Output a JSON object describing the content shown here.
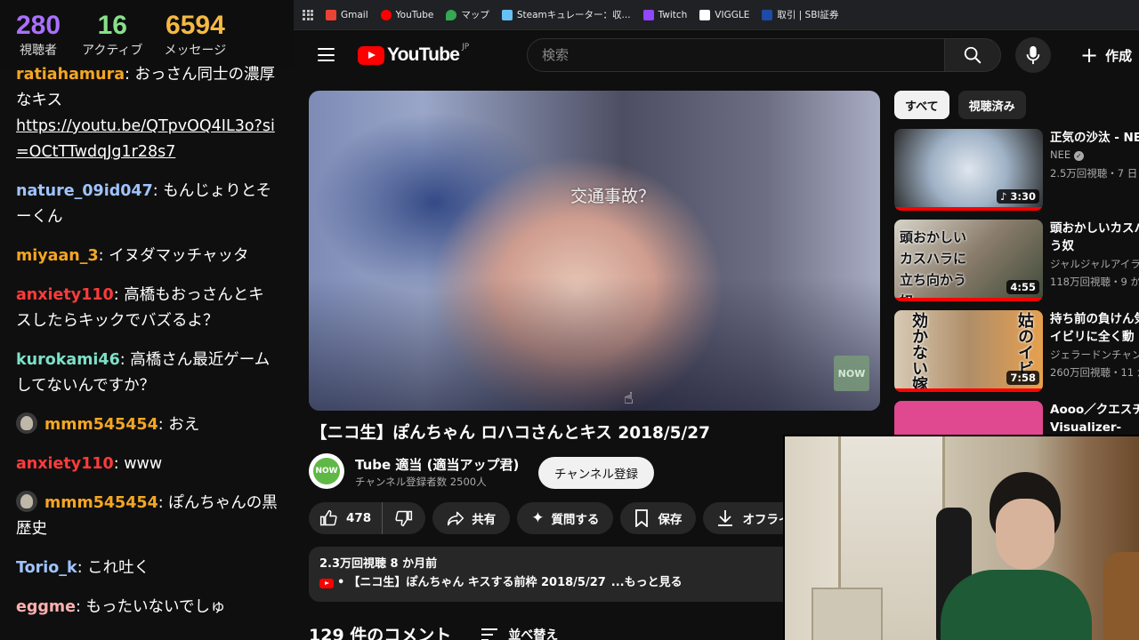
{
  "stream_stats": [
    {
      "value": "280",
      "label": "視聴者",
      "color": "#a970ff"
    },
    {
      "value": "16",
      "label": "アクティブ",
      "color": "#87e08a"
    },
    {
      "value": "6594",
      "label": "メッセージ",
      "color": "#f5b942"
    }
  ],
  "chat": [
    {
      "user": "ratiahamura",
      "color": "#f5a623",
      "text": ": おっさん同士の濃厚なキス",
      "link": "https://youtu.be/QTpvOQ4IL3o?si=OCtTTwdqJg1r28s7",
      "avatar": false
    },
    {
      "user": "nature_09id047",
      "color": "#9fc3ff",
      "text": ": もんじょりとそーくん",
      "avatar": false
    },
    {
      "user": "miyaan_3",
      "color": "#f5a623",
      "text": ": イヌダマッチャッタ",
      "avatar": false
    },
    {
      "user": "anxiety110",
      "color": "#ff3b3b",
      "text": ": 高橋もおっさんとキスしたらキックでバズるよ？",
      "avatar": false
    },
    {
      "user": "kurokami46",
      "color": "#7de0c8",
      "text": ": 高橋さん最近ゲームしてないんですか？",
      "avatar": false
    },
    {
      "user": "mmm545454",
      "color": "#f5a623",
      "text": ": おえ",
      "avatar": true
    },
    {
      "user": "anxiety110",
      "color": "#ff3b3b",
      "text": ": www",
      "avatar": false
    },
    {
      "user": "mmm545454",
      "color": "#f5a623",
      "text": ": ぽんちゃんの黒歴史",
      "avatar": true
    },
    {
      "user": "Torio_k",
      "color": "#9fc3ff",
      "text": ": これ吐く",
      "avatar": false
    },
    {
      "user": "eggme",
      "color": "#ffb0b0",
      "text": ": もったいないでしゅ",
      "avatar": false
    }
  ],
  "bookmarks": [
    {
      "label": "Gmail",
      "color": "#ea4335"
    },
    {
      "label": "YouTube",
      "color": "#ff0000"
    },
    {
      "label": "マップ",
      "color": "#34a853"
    },
    {
      "label": "Steamキュレーター：収...",
      "color": "#66c0f4"
    },
    {
      "label": "Twitch",
      "color": "#9146ff"
    },
    {
      "label": "VIGGLE",
      "color": "#ffffff"
    },
    {
      "label": "取引 | SBI証券",
      "color": "#1e4aa8"
    }
  ],
  "header": {
    "logo_text": "YouTube",
    "region": "JP",
    "search_placeholder": "検索",
    "create_label": "作成"
  },
  "player": {
    "caption": "交通事故？",
    "watermark": "NOW"
  },
  "video": {
    "title": "【ニコ生】ぽんちゃん ロハコさんとキス 2018/5/27",
    "channel_name": "Tube 適当 (適当アップ君)",
    "channel_subs": "チャンネル登録者数 2500人",
    "channel_avatar_text": "NOW",
    "subscribe_label": "チャンネル登録",
    "like_count": "478",
    "share_label": "共有",
    "ask_label": "質問する",
    "save_label": "保存",
    "offline_label": "オフライ",
    "views_age": "2.3万回視聴  8 か月前",
    "desc_line": "【ニコ生】ぽんちゃん キスする前枠 2018/5/27",
    "more_label": "...もっと見る",
    "comments_count": "129 件のコメント",
    "sort_label": "並べ替え"
  },
  "sidebar": {
    "chips": [
      "すべて",
      "視聴済み"
    ],
    "recs": [
      {
        "title": "正気の沙汰 - NEE",
        "channel": "NEE",
        "meta": "2.5万回視聴・7 日",
        "duration": "3:30",
        "thumb_text": ""
      },
      {
        "title": "頭おかしいカスハ",
        "title2": "う奴",
        "channel": "ジャルジャルアイラ",
        "meta": "118万回視聴・9 か",
        "duration": "4:55",
        "thumb_text": "頭おかしい カスハラに 立ち向かう奴"
      },
      {
        "title": "持ち前の負けん気",
        "title2": "イビリに全く動",
        "channel": "ジェラードンチャン",
        "meta": "260万回視聴・11 か",
        "duration": "7:58",
        "thumb_text_left": "効かない嫁",
        "thumb_text_right": "姑のイビ"
      },
      {
        "title": "Aooo／クエスチ",
        "title2": "Visualizer-",
        "channel": "",
        "meta": "",
        "duration": "",
        "thumb_text": ""
      }
    ]
  }
}
